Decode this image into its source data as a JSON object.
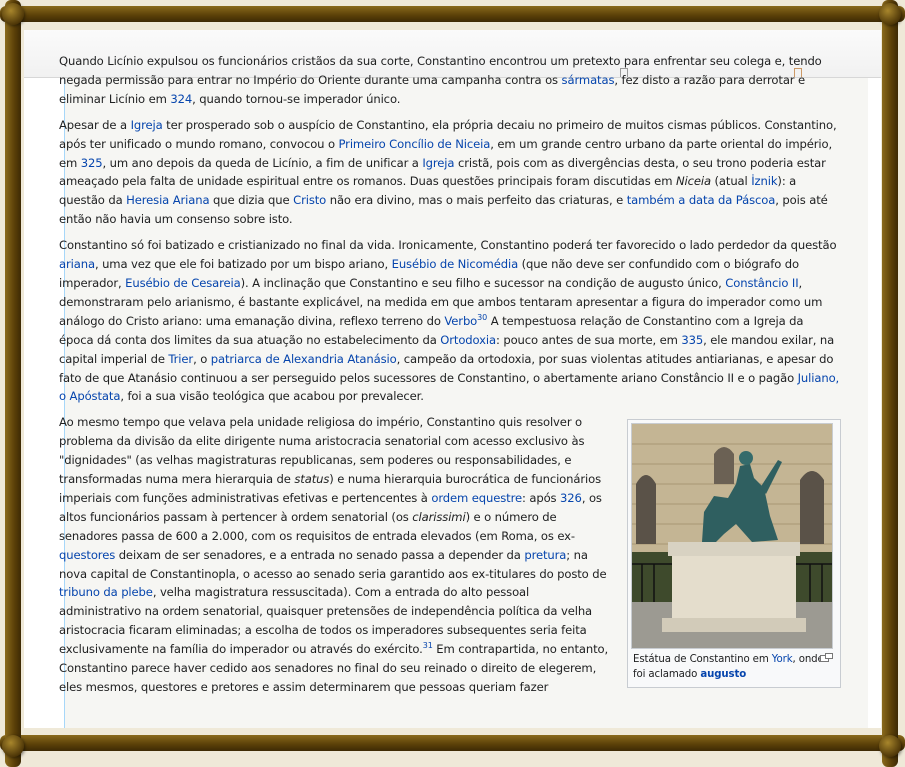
{
  "article": {
    "p1": {
      "t1": "Quando Licínio expulsou os funcionários cristãos da sua corte, Constantino encontrou um pretexto para enfrentar seu colega e, tendo negada permissão para entrar no Império do Oriente durante uma campanha contra os ",
      "l1": "sármatas",
      "t2": ", fez disto a razão para derrotar e eliminar Licínio em ",
      "l2": "324",
      "t3": ", quando tornou-se imperador único."
    },
    "p2": {
      "t1": "Apesar de a ",
      "l1": "Igreja",
      "t2": " ter prosperado sob o auspício de Constantino, ela própria decaiu no primeiro de muitos cismas públicos. Constantino, após ter unificado o mundo romano, convocou o ",
      "l2": "Primeiro Concílio de Niceia",
      "t3": ", em um grande centro urbano da parte oriental do império, em ",
      "l3": "325",
      "t4": ", um ano depois da queda de Licínio, a fim de unificar a ",
      "l4": "Igreja",
      "t5": " cristã, pois com as divergências desta, o seu trono poderia estar ameaçado pela falta de unidade espiritual entre os romanos. Duas questões principais foram discutidas em ",
      "i1": "Niceia",
      "t6": " (atual ",
      "l5": "İznik",
      "t7": "): a questão da ",
      "l6": "Heresia Ariana",
      "t8": " que dizia que ",
      "l7": "Cristo",
      "t9": " não era divino, mas o mais perfeito das criaturas, e ",
      "l8": "também a data da Páscoa",
      "t10": ", pois até então não havia um consenso sobre isto."
    },
    "p3": {
      "t1": "Constantino só foi batizado e cristianizado no final da vida. Ironicamente, Constantino poderá ter favorecido o lado perdedor da questão ",
      "l1": "ariana",
      "t2": ", uma vez que ele foi batizado por um bispo ariano, ",
      "l2": "Eusébio de Nicomédia",
      "t3": " (que não deve ser confundido com o biógrafo do imperador, ",
      "l3": "Eusébio de Cesareia",
      "t4": "). A inclinação que Constantino e seu filho e sucessor na condição de augusto único, ",
      "l4": "Constâncio II",
      "t5": ", demonstraram pelo arianismo, é bastante explicável, na medida em que ambos tentaram apresentar a figura do imperador como um análogo do Cristo ariano: uma emanação divina, reflexo terreno do ",
      "l5": "Verbo",
      "s1": "30",
      "t6": " A tempestuosa relação de Constantino com a Igreja da época dá conta dos limites da sua atuação no estabelecimento da ",
      "l6": "Ortodoxia",
      "t7": ": pouco antes de sua morte, em ",
      "l7": "335",
      "t8": ", ele mandou exilar, na capital imperial de ",
      "l8": "Trier",
      "t9": ", o ",
      "l9": "patriarca de Alexandria Atanásio",
      "t10": ", campeão da ortodoxia, por suas violentas atitudes antiarianas, e apesar do fato de que Atanásio continuou a ser perseguido pelos sucessores de Constantino, o abertamente ariano Constâncio II e o pagão ",
      "l10": "Juliano, o Apóstata",
      "t11": ", foi a sua visão teológica que acabou por prevalecer."
    },
    "p4": {
      "t1": "Ao mesmo tempo que velava pela unidade religiosa do império, Constantino quis resolver o problema da divisão da elite dirigente numa aristocracia senatorial com acesso exclusivo às \"dignidades\" (as velhas magistraturas republicanas, sem poderes ou responsabilidades, e transformadas numa mera hierarquia de ",
      "i1": "status",
      "t2": ") e numa hierarquia burocrática de funcionários imperiais com funções administrativas efetivas e pertencentes à ",
      "l1": "ordem equestre",
      "t3": ": após ",
      "l2": "326",
      "t4": ", os altos funcionários passam à pertencer à ordem senatorial (os ",
      "i2": "clarissimi",
      "t5": ") e o número de senadores passa de 600 a 2.000, com os requisitos de entrada elevados (em Roma, os ex-",
      "l3": "questores",
      "t6": " deixam de ser senadores, e a entrada no senado passa a depender da ",
      "l4": "pretura",
      "t7": "; na nova capital de Constantinopla, o acesso ao senado seria garantido aos ex-titulares do posto de ",
      "l5": "tribuno da plebe",
      "t8": ", velha magistratura ressuscitada). Com a entrada do alto pessoal administrativo na ordem senatorial, quaisquer pretensões de independência política da velha aristocracia ficaram eliminadas; a escolha de todos os imperadores subsequentes seria feita exclusivamente na família do imperador ou através do exército.",
      "s1": "31",
      "t9": " Em contrapartida, no entanto, Constantino parece haver cedido aos senadores no final do seu reinado o direito de elegerem, eles mesmos, questores e pretores e assim determinarem que pessoas queriam fazer"
    },
    "thumb": {
      "c1": "Estátua de Constantino em ",
      "l1": "York",
      "c2": ", onde foi aclamado ",
      "l2": "augusto"
    }
  }
}
